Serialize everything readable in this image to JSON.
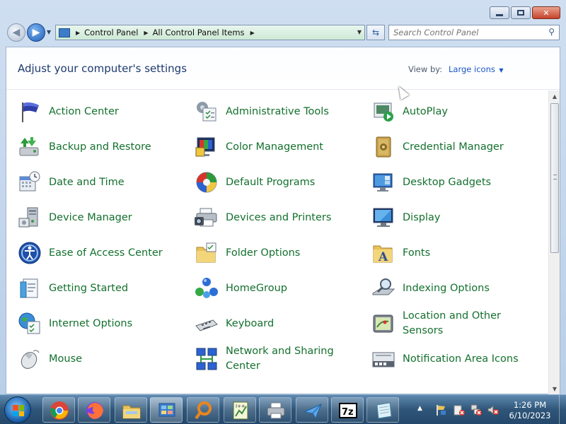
{
  "window": {
    "controls": {
      "minimize": "—",
      "maximize": "□",
      "close": "✕"
    }
  },
  "navbar": {
    "breadcrumbs": [
      "Control Panel",
      "All Control Panel Items"
    ],
    "search_placeholder": "Search Control Panel"
  },
  "header": {
    "title": "Adjust your computer's settings",
    "view_by_label": "View by:",
    "view_by_value": "Large icons"
  },
  "items": [
    {
      "label": "Action Center",
      "icon": "flag-icon"
    },
    {
      "label": "Administrative Tools",
      "icon": "admin-tools-icon"
    },
    {
      "label": "AutoPlay",
      "icon": "autoplay-icon"
    },
    {
      "label": "Backup and Restore",
      "icon": "backup-icon"
    },
    {
      "label": "Color Management",
      "icon": "color-management-icon"
    },
    {
      "label": "Credential Manager",
      "icon": "credential-vault-icon"
    },
    {
      "label": "Date and Time",
      "icon": "calendar-clock-icon"
    },
    {
      "label": "Default Programs",
      "icon": "default-programs-icon"
    },
    {
      "label": "Desktop Gadgets",
      "icon": "gadgets-icon"
    },
    {
      "label": "Device Manager",
      "icon": "device-manager-icon"
    },
    {
      "label": "Devices and Printers",
      "icon": "printer-camera-icon"
    },
    {
      "label": "Display",
      "icon": "monitor-icon"
    },
    {
      "label": "Ease of Access Center",
      "icon": "ease-of-access-icon"
    },
    {
      "label": "Folder Options",
      "icon": "folder-options-icon"
    },
    {
      "label": "Fonts",
      "icon": "fonts-folder-icon"
    },
    {
      "label": "Getting Started",
      "icon": "getting-started-icon"
    },
    {
      "label": "HomeGroup",
      "icon": "homegroup-icon"
    },
    {
      "label": "Indexing Options",
      "icon": "indexing-icon"
    },
    {
      "label": "Internet Options",
      "icon": "globe-icon"
    },
    {
      "label": "Keyboard",
      "icon": "keyboard-icon"
    },
    {
      "label": "Location and Other Sensors",
      "icon": "sensors-icon"
    },
    {
      "label": "Mouse",
      "icon": "mouse-icon"
    },
    {
      "label": "Network and Sharing Center",
      "icon": "network-icon"
    },
    {
      "label": "Notification Area Icons",
      "icon": "notification-area-icon"
    }
  ],
  "taskbar": {
    "apps": [
      "start",
      "chrome",
      "firefox",
      "explorer",
      "control-panel",
      "search",
      "editor",
      "fax-printer",
      "send",
      "7zip",
      "notepad"
    ],
    "clock_time": "1:26 PM",
    "clock_date": "6/10/2023",
    "colors": {
      "link_green": "#14702e",
      "title_blue": "#1e3a6e"
    }
  }
}
